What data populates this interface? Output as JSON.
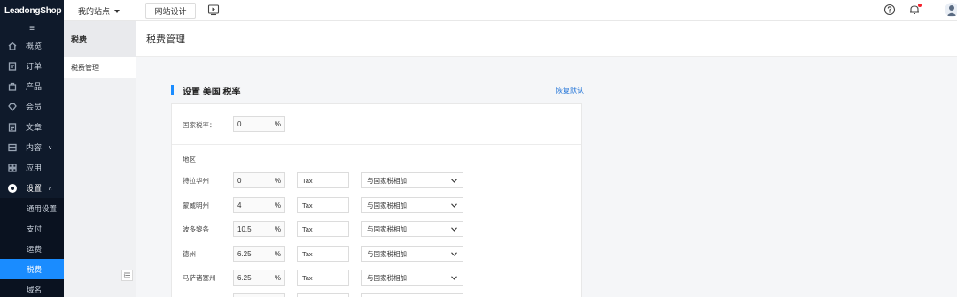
{
  "brand": {
    "logo_text": "LeadongShop"
  },
  "sidebar": {
    "menu_toggle": "≡",
    "items": [
      {
        "label": "概览",
        "icon": "home-icon"
      },
      {
        "label": "订单",
        "icon": "order-icon"
      },
      {
        "label": "产品",
        "icon": "product-icon"
      },
      {
        "label": "会员",
        "icon": "member-icon"
      },
      {
        "label": "文章",
        "icon": "article-icon"
      },
      {
        "label": "内容",
        "icon": "content-icon"
      },
      {
        "label": "应用",
        "icon": "app-icon"
      },
      {
        "label": "设置",
        "icon": "settings-icon"
      }
    ],
    "settings_sub": [
      "通用设置",
      "支付",
      "运费",
      "税费",
      "域名"
    ],
    "active_sub": "税费"
  },
  "topbar": {
    "site_select": "我的站点",
    "design_button": "网站设计"
  },
  "subnav": {
    "header": "税费",
    "items": [
      "税费管理"
    ]
  },
  "page": {
    "title": "税费管理"
  },
  "tax": {
    "section_title": "设置 美国 税率",
    "reset_link": "恢复默认",
    "country_label": "国家税率：",
    "country_rate": "0",
    "percent_sign": "%",
    "region_header": "地区",
    "regions": [
      {
        "name": "特拉华州",
        "rate": "0",
        "tax_name": "Tax",
        "mode": "与国家税相加"
      },
      {
        "name": "蒙威明州",
        "rate": "4",
        "tax_name": "Tax",
        "mode": "与国家税相加"
      },
      {
        "name": "波多黎各",
        "rate": "10.5",
        "tax_name": "Tax",
        "mode": "与国家税相加"
      },
      {
        "name": "德州",
        "rate": "6.25",
        "tax_name": "Tax",
        "mode": "与国家税相加"
      },
      {
        "name": "马萨诸塞州",
        "rate": "6.25",
        "tax_name": "Tax",
        "mode": "与国家税相加"
      }
    ]
  }
}
